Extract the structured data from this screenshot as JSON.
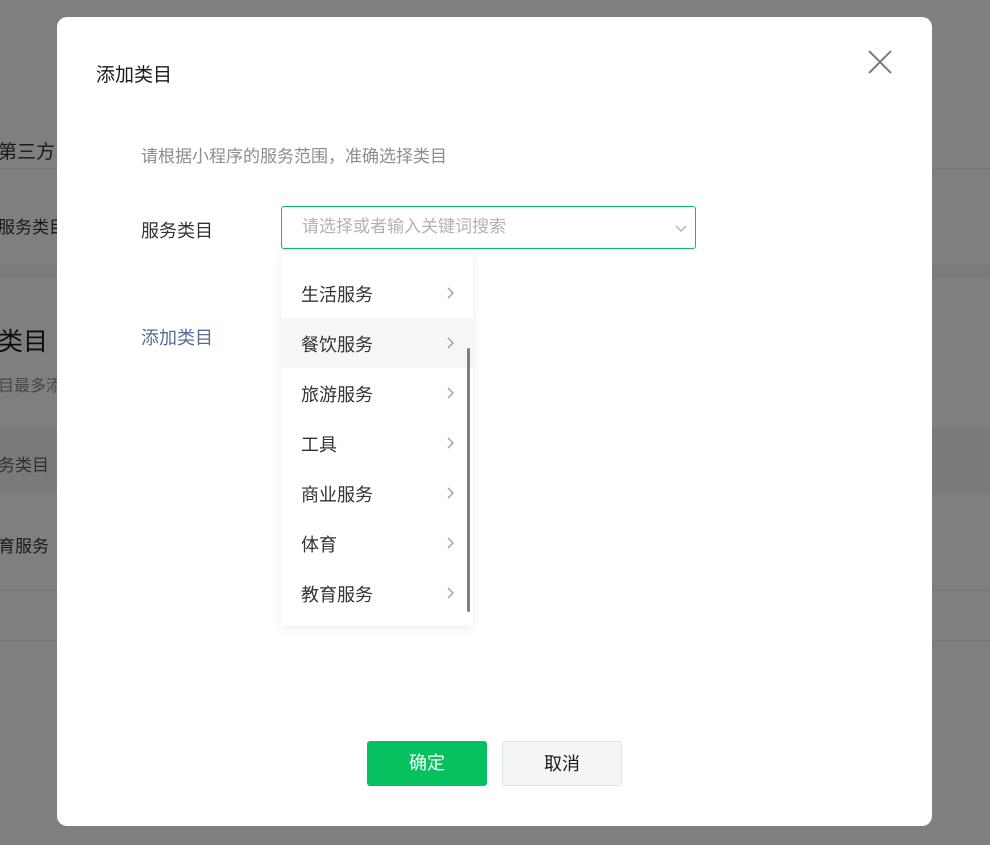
{
  "background": {
    "section_title": "第三方",
    "row_label": "服务类目",
    "heading": "类目",
    "note": "目最多添",
    "table_header": "务类目",
    "table_cell": "育服务"
  },
  "dialog": {
    "title": "添加类目",
    "tip": "请根据小程序的服务范围，准确选择类目",
    "field_label": "服务类目",
    "select_placeholder": "请选择或者输入关键词搜索",
    "select_value": "",
    "add_link": "添加类目",
    "confirm_label": "确定",
    "cancel_label": "取消"
  },
  "menu": {
    "items": [
      {
        "label": "生活服务",
        "active": false
      },
      {
        "label": "餐饮服务",
        "active": true
      },
      {
        "label": "旅游服务",
        "active": false
      },
      {
        "label": "工具",
        "active": false
      },
      {
        "label": "商业服务",
        "active": false
      },
      {
        "label": "体育",
        "active": false
      },
      {
        "label": "教育服务",
        "active": false
      }
    ]
  },
  "colors": {
    "accent": "#07c160",
    "link": "#576b95",
    "active_item_bg": "#f5f6f7"
  },
  "icons": {
    "close": "close-icon",
    "select_arrow": "chevron-down-icon",
    "menu_arrow": "chevron-right-icon"
  }
}
